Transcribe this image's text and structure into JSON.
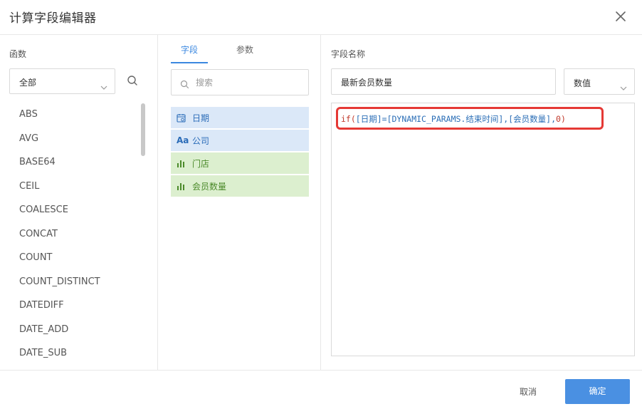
{
  "dialog": {
    "title": "计算字段编辑器"
  },
  "functions": {
    "label": "函数",
    "filter_value": "全部",
    "items": [
      "ABS",
      "AVG",
      "BASE64",
      "CEIL",
      "COALESCE",
      "CONCAT",
      "COUNT",
      "COUNT_DISTINCT",
      "DATEDIFF",
      "DATE_ADD",
      "DATE_SUB"
    ]
  },
  "fields_panel": {
    "tabs": [
      {
        "label": "字段",
        "active": true
      },
      {
        "label": "参数",
        "active": false
      }
    ],
    "search_placeholder": "搜索",
    "items": [
      {
        "label": "日期",
        "kind": "date",
        "icon": "calendar-icon"
      },
      {
        "label": "公司",
        "kind": "text",
        "icon": "text-aa-icon",
        "icon_text": "Aa"
      },
      {
        "label": "门店",
        "kind": "measure",
        "icon": "bar-chart-icon"
      },
      {
        "label": "会员数量",
        "kind": "measure",
        "icon": "bar-chart-icon"
      }
    ]
  },
  "editor": {
    "name_label": "字段名称",
    "name_value": "最新会员数量",
    "type_value": "数值",
    "formula": {
      "fn": "if(",
      "field1": "[日期]",
      "op": "=",
      "param": "[DYNAMIC_PARAMS.结束时间]",
      "sep1": ",",
      "field2": "[会员数量]",
      "sep2": ",",
      "value": "0",
      "close": ")"
    }
  },
  "footer": {
    "cancel_label": "取消",
    "confirm_label": "确定"
  },
  "colors": {
    "accent": "#4a90e2",
    "highlight_border": "#e53935",
    "dimension_bg": "#dbe8f8",
    "measure_bg": "#dcefcf"
  }
}
